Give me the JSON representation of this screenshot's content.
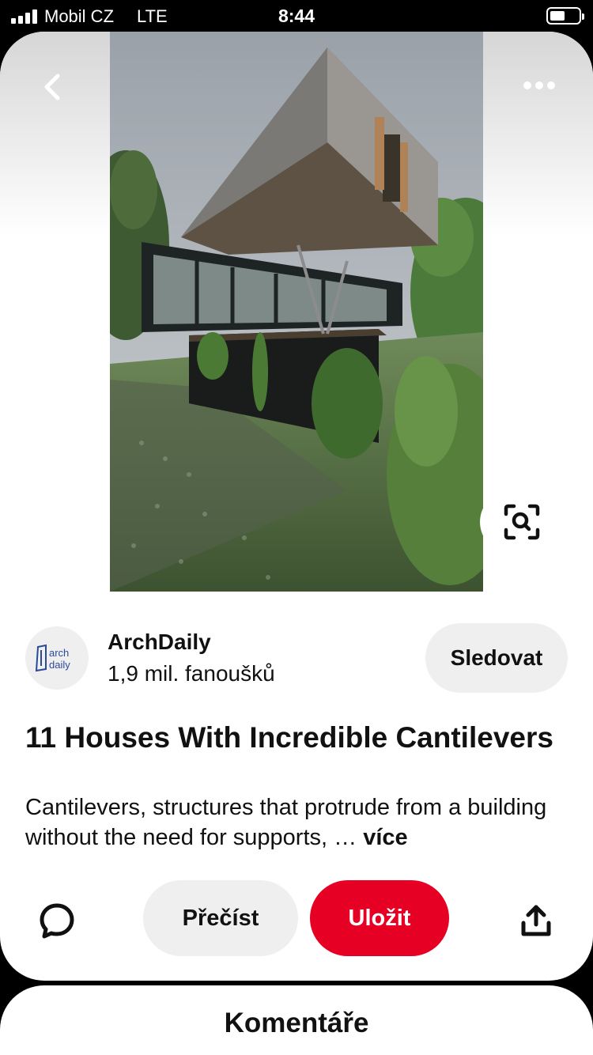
{
  "status_bar": {
    "carrier": "Mobil CZ",
    "network": "LTE",
    "time": "8:44"
  },
  "pin": {
    "image_icon": "house-photo",
    "title": "11 Houses With Incredible Cantilevers",
    "description": "Cantilevers, structures that protrude from a building without the need for supports, …",
    "more_label": "více"
  },
  "creator": {
    "name": "ArchDaily",
    "followers": "1,9 mil. fanoušků",
    "logo_line1": "arch",
    "logo_line2": "daily",
    "follow_label": "Sledovat"
  },
  "actions": {
    "read_label": "Přečíst",
    "save_label": "Uložit"
  },
  "comments": {
    "title": "Komentáře"
  },
  "colors": {
    "save_red": "#e60023",
    "pill_gray": "#efefef",
    "logo_blue": "#2b4a9a"
  }
}
